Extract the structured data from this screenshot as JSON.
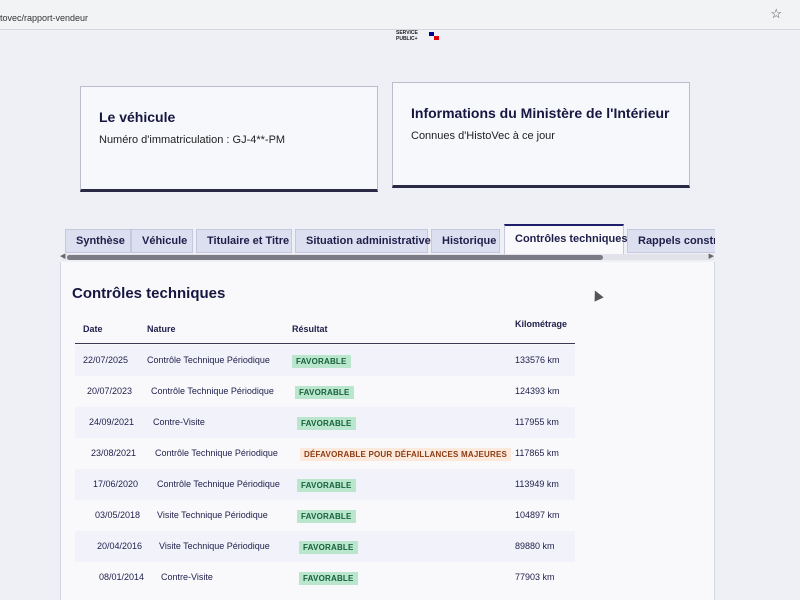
{
  "browser": {
    "url": "tovec/rapport-vendeur",
    "bookmark_icon": "star-icon"
  },
  "logo": {
    "line1": "SERVICE",
    "line2": "PUBLIC+",
    "colors": [
      "#e1000f",
      "#000091"
    ]
  },
  "vehicle_card": {
    "title": "Le véhicule",
    "plate_text": "Numéro d'immatriculation : GJ-4**-PM"
  },
  "ministry_card": {
    "title": "Informations du Ministère de l'Intérieur",
    "subtitle": "Connues d'HistoVec à ce jour"
  },
  "tabs": [
    {
      "label": "Synthèse",
      "active": false
    },
    {
      "label": "Véhicule",
      "active": false
    },
    {
      "label": "Titulaire et Titre",
      "active": false
    },
    {
      "label": "Situation administrative",
      "active": false
    },
    {
      "label": "Historique",
      "active": false
    },
    {
      "label": "Contrôles techniques",
      "active": true
    },
    {
      "label": "Rappels constru",
      "active": false
    }
  ],
  "section": {
    "title": "Contrôles techniques",
    "columns": [
      "Date",
      "Nature",
      "Résultat",
      "Kilométrage"
    ],
    "rows": [
      {
        "date": "22/07/2025",
        "nature": "Contrôle Technique Périodique",
        "result": "FAVORABLE",
        "status": "fav",
        "km": "133576 km"
      },
      {
        "date": "20/07/2023",
        "nature": "Contrôle Technique Périodique",
        "result": "FAVORABLE",
        "status": "fav",
        "km": "124393 km"
      },
      {
        "date": "24/09/2021",
        "nature": "Contre-Visite",
        "result": "FAVORABLE",
        "status": "fav",
        "km": "117955 km"
      },
      {
        "date": "23/08/2021",
        "nature": "Contrôle Technique Périodique",
        "result": "DÉFAVORABLE POUR DÉFAILLANCES MAJEURES",
        "status": "defav",
        "km": "117865 km"
      },
      {
        "date": "17/06/2020",
        "nature": "Contrôle Technique Périodique",
        "result": "FAVORABLE",
        "status": "fav",
        "km": "113949 km"
      },
      {
        "date": "03/05/2018",
        "nature": "Visite Technique Périodique",
        "result": "FAVORABLE",
        "status": "fav",
        "km": "104897 km"
      },
      {
        "date": "20/04/2016",
        "nature": "Visite Technique Périodique",
        "result": "FAVORABLE",
        "status": "fav",
        "km": "89880 km"
      },
      {
        "date": "08/01/2014",
        "nature": "Contre-Visite",
        "result": "FAVORABLE",
        "status": "fav",
        "km": "77903 km"
      }
    ]
  },
  "colors": {
    "favorable_bg": "#b9e6cd",
    "favorable_text": "#16623a",
    "defavorable_bg": "#fde9dc",
    "defavorable_text": "#8a3c12",
    "active_tab_border": "#1e1e6a"
  }
}
